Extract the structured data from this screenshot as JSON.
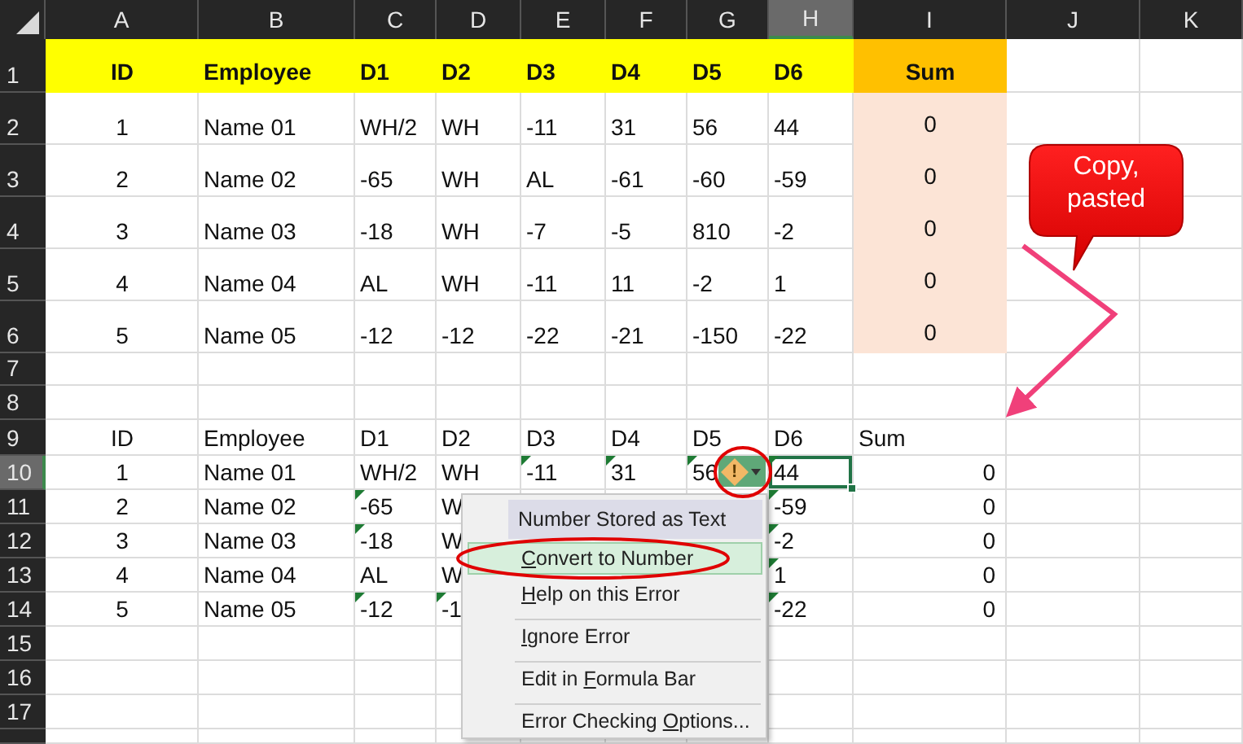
{
  "column_headers": [
    {
      "label": "A",
      "selected": false
    },
    {
      "label": "B",
      "selected": false
    },
    {
      "label": "C",
      "selected": false
    },
    {
      "label": "D",
      "selected": false
    },
    {
      "label": "E",
      "selected": false
    },
    {
      "label": "F",
      "selected": false
    },
    {
      "label": "G",
      "selected": false
    },
    {
      "label": "H",
      "selected": true
    },
    {
      "label": "I",
      "selected": false
    },
    {
      "label": "J",
      "selected": false
    },
    {
      "label": "K",
      "selected": false
    }
  ],
  "row_headers": [
    {
      "label": "1",
      "selected": false
    },
    {
      "label": "2",
      "selected": false
    },
    {
      "label": "3",
      "selected": false
    },
    {
      "label": "4",
      "selected": false
    },
    {
      "label": "5",
      "selected": false
    },
    {
      "label": "6",
      "selected": false
    },
    {
      "label": "7",
      "selected": false
    },
    {
      "label": "8",
      "selected": false
    },
    {
      "label": "9",
      "selected": false
    },
    {
      "label": "10",
      "selected": true
    },
    {
      "label": "11",
      "selected": false
    },
    {
      "label": "12",
      "selected": false
    },
    {
      "label": "13",
      "selected": false
    },
    {
      "label": "14",
      "selected": false
    },
    {
      "label": "15",
      "selected": false
    },
    {
      "label": "16",
      "selected": false
    },
    {
      "label": "17",
      "selected": false
    }
  ],
  "top_table": {
    "header": [
      "ID",
      "Employee",
      "D1",
      "D2",
      "D3",
      "D4",
      "D5",
      "D6"
    ],
    "sum_header": "Sum",
    "rows": [
      {
        "id": "1",
        "employee": "Name 01",
        "values": [
          "WH/2",
          "WH",
          "-11",
          "31",
          "56",
          "44"
        ],
        "sum": "0"
      },
      {
        "id": "2",
        "employee": "Name 02",
        "values": [
          "-65",
          "WH",
          "AL",
          "-61",
          "-60",
          "-59"
        ],
        "sum": "0"
      },
      {
        "id": "3",
        "employee": "Name 03",
        "values": [
          "-18",
          "WH",
          "-7",
          "-5",
          "810",
          "-2"
        ],
        "sum": "0"
      },
      {
        "id": "4",
        "employee": "Name 04",
        "values": [
          "AL",
          "WH",
          "-11",
          "11",
          "-2",
          "1"
        ],
        "sum": "0"
      },
      {
        "id": "5",
        "employee": "Name 05",
        "values": [
          "-12",
          "-12",
          "-22",
          "-21",
          "-150",
          "-22"
        ],
        "sum": "0"
      }
    ]
  },
  "bottom_table": {
    "header": [
      "ID",
      "Employee",
      "D1",
      "D2",
      "D3",
      "D4",
      "D5",
      "D6"
    ],
    "sum_header": "Sum",
    "rows": [
      {
        "id": "1",
        "employee": "Name 01",
        "values": [
          {
            "text": "WH/2",
            "flagged": false,
            "selected": false
          },
          {
            "text": "WH",
            "flagged": false,
            "selected": false
          },
          {
            "text": "-11",
            "flagged": true,
            "selected": false
          },
          {
            "text": "31",
            "flagged": true,
            "selected": false
          },
          {
            "text": "56",
            "flagged": true,
            "selected": false
          }
        ],
        "d6": {
          "text": "44",
          "flagged": true,
          "selected": true
        },
        "sum": "0"
      },
      {
        "id": "2",
        "employee": "Name 02",
        "values": [
          {
            "text": "-65",
            "flagged": true,
            "selected": false
          },
          {
            "text": "W",
            "flagged": false,
            "selected": false
          }
        ],
        "d6": {
          "text": "-59",
          "flagged": true,
          "selected": false
        },
        "sum": "0"
      },
      {
        "id": "3",
        "employee": "Name 03",
        "values": [
          {
            "text": "-18",
            "flagged": true,
            "selected": false
          },
          {
            "text": "W",
            "flagged": false,
            "selected": false
          }
        ],
        "d6": {
          "text": "-2",
          "flagged": true,
          "selected": false
        },
        "sum": "0"
      },
      {
        "id": "4",
        "employee": "Name 04",
        "values": [
          {
            "text": "AL",
            "flagged": false,
            "selected": false
          },
          {
            "text": "W",
            "flagged": false,
            "selected": false
          }
        ],
        "d6": {
          "text": "1",
          "flagged": true,
          "selected": false
        },
        "sum": "0"
      },
      {
        "id": "5",
        "employee": "Name 05",
        "values": [
          {
            "text": "-12",
            "flagged": true,
            "selected": false
          },
          {
            "text": "-1",
            "flagged": true,
            "selected": false
          }
        ],
        "d6": {
          "text": "-22",
          "flagged": true,
          "selected": false
        },
        "sum": "0"
      }
    ]
  },
  "error_button": {
    "symbol": "!"
  },
  "error_menu": {
    "title": "Number Stored as Text",
    "items": [
      {
        "key": "C",
        "after": "onvert to Number",
        "selected": true,
        "separator": false
      },
      {
        "key": "H",
        "after": "elp on this Error",
        "selected": false,
        "separator": false
      },
      {
        "key": "I",
        "after": "gnore Error",
        "selected": false,
        "separator": true
      },
      {
        "before": "Edit in ",
        "key": "F",
        "after": "ormula Bar",
        "selected": false,
        "separator": true
      },
      {
        "before": "Error Checking ",
        "key": "O",
        "after": "ptions...",
        "selected": false,
        "separator": true
      }
    ]
  },
  "callout": {
    "lines": [
      "Copy,",
      "pasted"
    ]
  }
}
